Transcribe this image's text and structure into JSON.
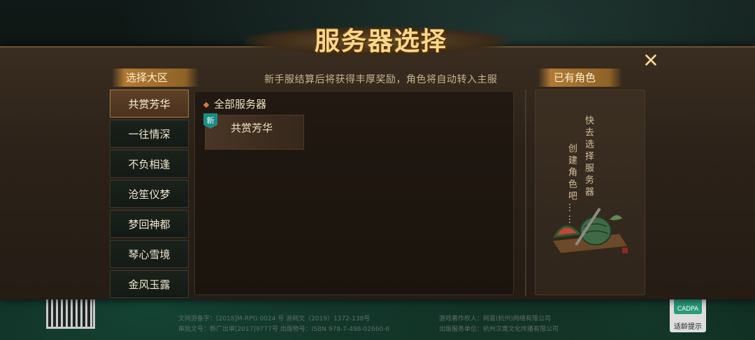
{
  "dialog": {
    "title": "服务器选择",
    "close_label": "✕"
  },
  "zones": {
    "header": "选择大区",
    "items": [
      {
        "label": "共赏芳华",
        "selected": true
      },
      {
        "label": "一往情深",
        "selected": false
      },
      {
        "label": "不负相逢",
        "selected": false
      },
      {
        "label": "沧笙仪梦",
        "selected": false
      },
      {
        "label": "梦回神都",
        "selected": false
      },
      {
        "label": "琴心雪境",
        "selected": false
      },
      {
        "label": "金风玉露",
        "selected": false
      }
    ]
  },
  "servers": {
    "notice": "新手服结算后将获得丰厚奖励，角色将自动转入主服",
    "all_label": "全部服务器",
    "list": [
      {
        "name": "共赏芳华",
        "badge": "新"
      }
    ]
  },
  "roles": {
    "header": "已有角色",
    "hint_line1": "快去选择服务器",
    "hint_line2": "创建角色吧……"
  },
  "footer": {
    "line1_left": "文网游备字：[2018]M-RPG 0024 号    浙网文（2019）1372-138号",
    "line2_left": "审批文号：新广出审[2017]9777号    出版物号：ISBN 978-7-498-02660-6",
    "line1_right": "游戏著作权人：网易(杭州)网络有限公司",
    "line2_right": "出版服务单位：杭州汉唐文化传播有限公司"
  },
  "age_rating": {
    "badge": "CADPA",
    "label": "适龄提示"
  },
  "colors": {
    "title_gold": "#f7d98a",
    "selected_zone": "#5e4026",
    "new_badge": "#1d8b84"
  }
}
